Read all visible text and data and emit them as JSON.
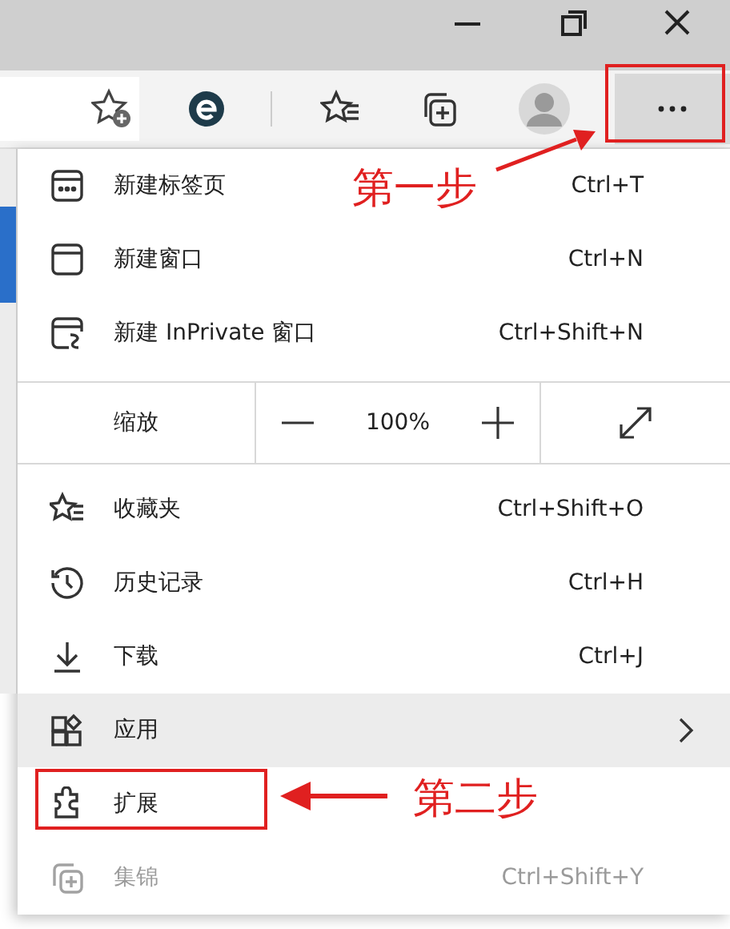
{
  "toolbar": {
    "more_button": {
      "pressed": true
    }
  },
  "menu": {
    "items": [
      {
        "kind": "item",
        "label": "新建标签页",
        "shortcut": "Ctrl+T",
        "selected": false,
        "disabled": false
      },
      {
        "kind": "item",
        "label": "新建窗口",
        "shortcut": "Ctrl+N",
        "selected": false,
        "disabled": false
      },
      {
        "kind": "item",
        "label": "新建 InPrivate 窗口",
        "shortcut": "Ctrl+Shift+N",
        "selected": false,
        "disabled": false
      },
      {
        "kind": "zoom",
        "label": "缩放",
        "value": "100%"
      },
      {
        "kind": "item",
        "label": "收藏夹",
        "shortcut": "Ctrl+Shift+O",
        "selected": false,
        "disabled": false
      },
      {
        "kind": "item",
        "label": "历史记录",
        "shortcut": "Ctrl+H",
        "selected": false,
        "disabled": false
      },
      {
        "kind": "item",
        "label": "下载",
        "shortcut": "Ctrl+J",
        "selected": false,
        "disabled": false
      },
      {
        "kind": "submenu",
        "label": "应用",
        "selected": true,
        "disabled": false
      },
      {
        "kind": "item",
        "label": "扩展",
        "selected": false,
        "disabled": false
      },
      {
        "kind": "item",
        "label": "集锦",
        "shortcut": "Ctrl+Shift+Y",
        "selected": false,
        "disabled": true
      }
    ]
  },
  "annotations": [
    {
      "text": "第一步"
    },
    {
      "text": "第二步"
    }
  ]
}
